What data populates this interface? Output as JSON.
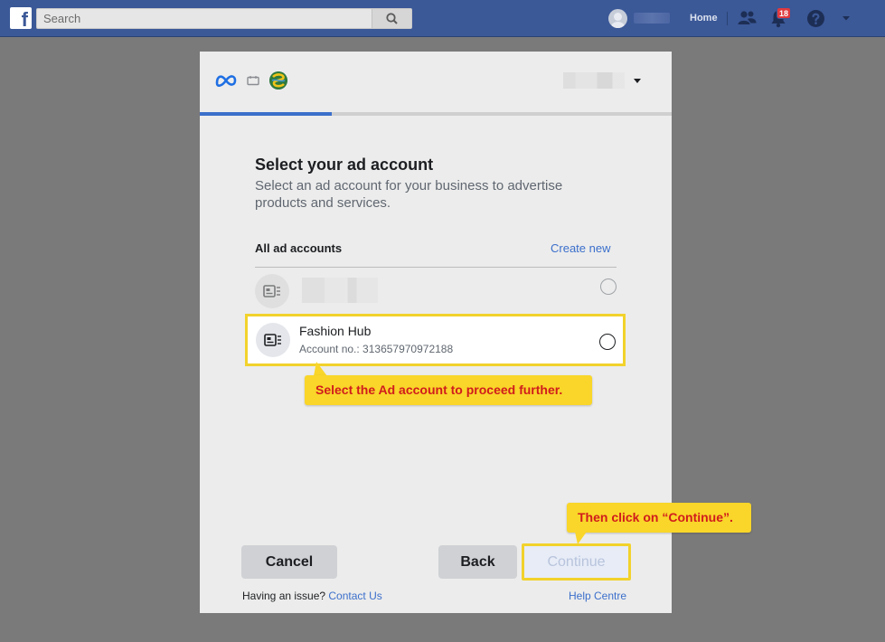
{
  "topbar": {
    "logo_letter": "f",
    "search_placeholder": "Search",
    "home_label": "Home",
    "notification_count": "18"
  },
  "dialog": {
    "progress_fraction": 0.28,
    "title": "Select your ad account",
    "subtitle": "Select an ad account for your business to advertise products and services.",
    "section_label": "All ad accounts",
    "create_new_label": "Create new",
    "accounts": [
      {
        "name": "",
        "number": "",
        "selected": false,
        "obscured": true
      },
      {
        "name": "Fashion Hub",
        "number": "Account no.: 313657970972188",
        "selected": false,
        "obscured": false
      }
    ],
    "buttons": {
      "cancel": "Cancel",
      "back": "Back",
      "continue": "Continue"
    },
    "footer": {
      "issue_text": "Having an issue?",
      "contact_link": "Contact Us",
      "help_link": "Help Centre"
    }
  },
  "callouts": {
    "select_account": "Select the Ad account to proceed further.",
    "continue_hint": "Then click on “Continue”."
  },
  "colors": {
    "facebook_blue": "#3b5897",
    "link_blue": "#3b6fcb",
    "callout_yellow": "#f9d629",
    "callout_text_red": "#d11c1c",
    "highlight_border": "#f2d22c"
  },
  "icons": [
    "facebook-logo-icon",
    "search-icon",
    "friends-icon",
    "bell-icon",
    "help-icon",
    "caret-down-icon",
    "meta-logo-icon",
    "page-icon",
    "brand-logo-icon",
    "ad-account-icon"
  ]
}
